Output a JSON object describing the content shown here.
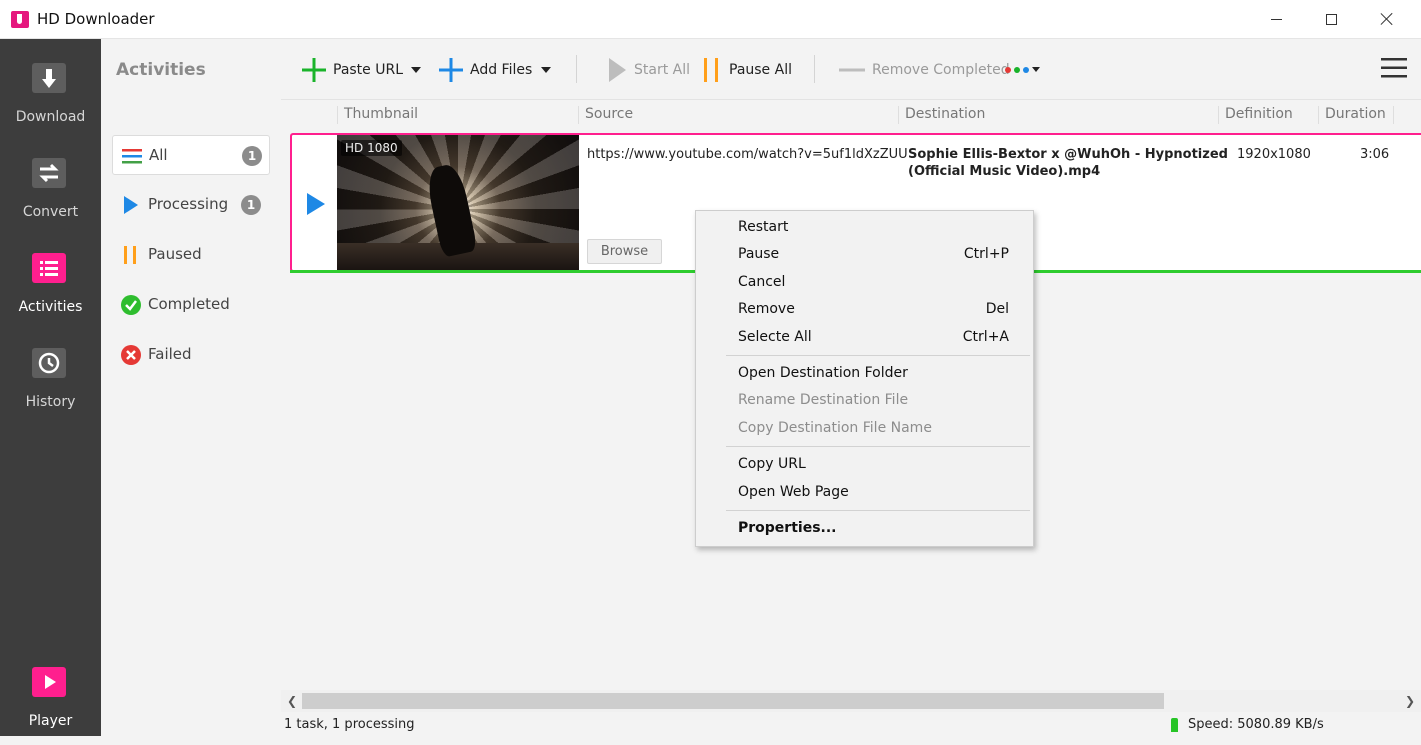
{
  "window": {
    "title": "HD Downloader"
  },
  "nav": {
    "download": "Download",
    "convert": "Convert",
    "activities": "Activities",
    "history": "History",
    "player": "Player"
  },
  "panel": {
    "title": "Activities",
    "filters": [
      {
        "label": "All",
        "count": "1"
      },
      {
        "label": "Processing",
        "count": "1"
      },
      {
        "label": "Paused"
      },
      {
        "label": "Completed"
      },
      {
        "label": "Failed"
      }
    ]
  },
  "toolbar": {
    "paste_url": "Paste URL",
    "add_files": "Add Files",
    "start_all": "Start All",
    "pause_all": "Pause All",
    "remove_completed": "Remove Completed"
  },
  "columns": {
    "thumbnail": "Thumbnail",
    "source": "Source",
    "destination": "Destination",
    "definition": "Definition",
    "duration": "Duration"
  },
  "task": {
    "badge": "HD 1080",
    "source": "https://www.youtube.com/watch?v=5uf1ldXzZUU",
    "browse": "Browse",
    "destination": "Sophie Ellis-Bextor x @WuhOh - Hypnotized (Official Music Video).mp4",
    "definition": "1920x1080",
    "duration": "3:06",
    "progress": 1.0
  },
  "context_menu": {
    "restart": "Restart",
    "pause": "Pause",
    "pause_sc": "Ctrl+P",
    "cancel": "Cancel",
    "remove": "Remove",
    "remove_sc": "Del",
    "select_all": "Selecte All",
    "select_all_sc": "Ctrl+A",
    "open_folder": "Open Destination Folder",
    "rename": "Rename Destination File",
    "copy_name": "Copy Destination File Name",
    "copy_url": "Copy URL",
    "open_web": "Open Web Page",
    "properties": "Properties..."
  },
  "status": {
    "tasks": "1 task, 1 processing",
    "speed": "Speed: 5080.89 KB/s"
  },
  "colors": {
    "accent": "#ff1f8e",
    "progress": "#2ecc2e",
    "play": "#1e88e5",
    "pause": "#ff9f1a"
  }
}
